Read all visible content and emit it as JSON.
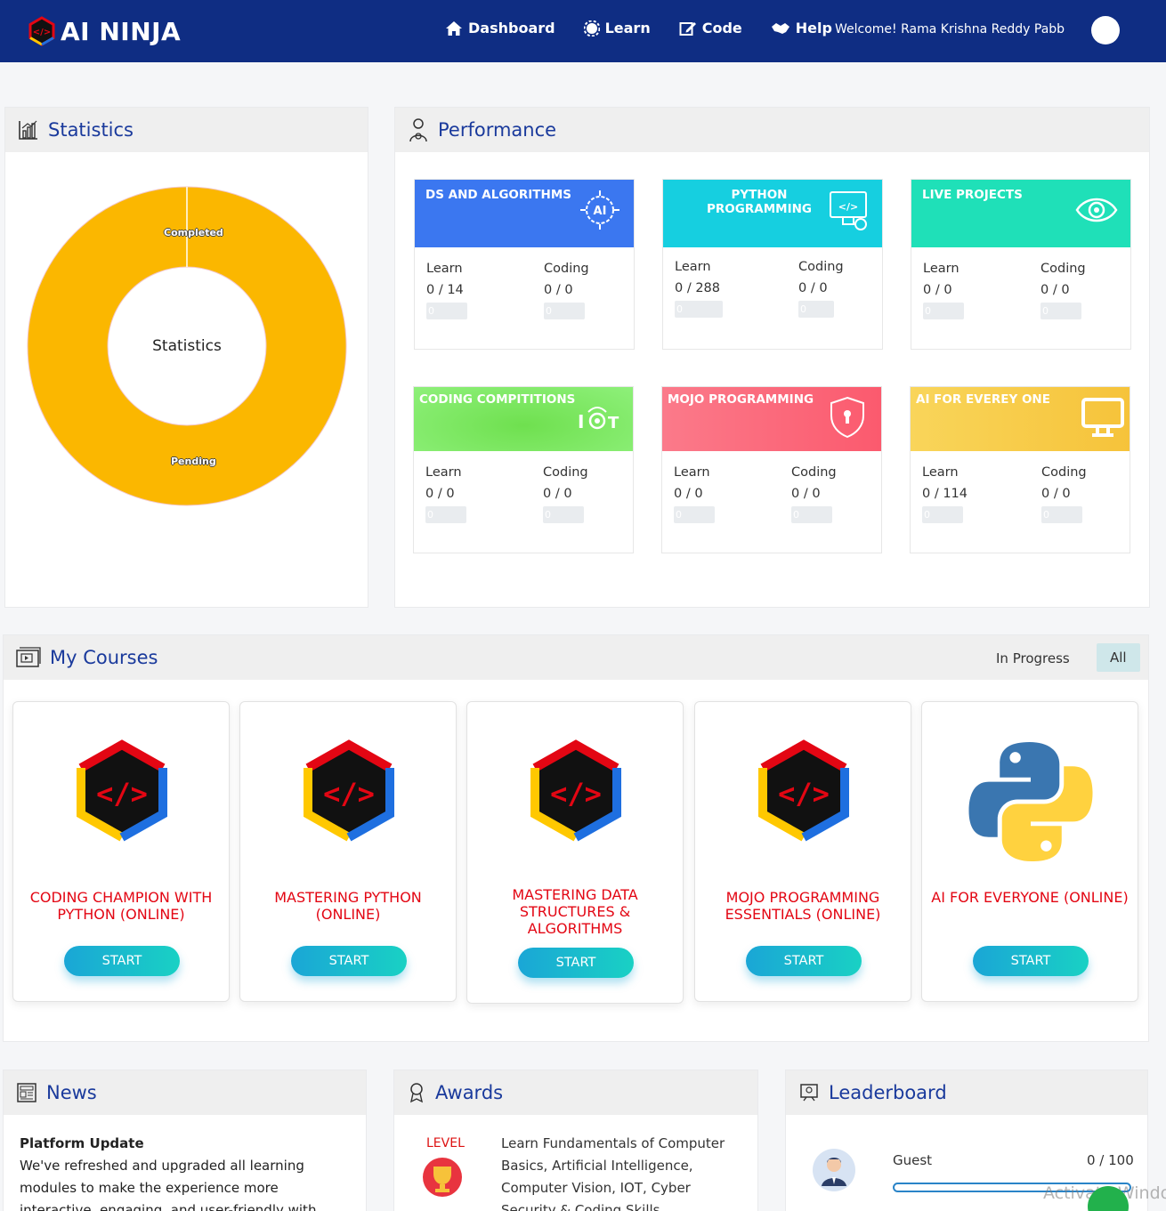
{
  "header": {
    "logo_text": "AI NINJA",
    "nav": [
      {
        "label": "Dashboard",
        "icon": "home-icon"
      },
      {
        "label": "Learn",
        "icon": "gear-icon"
      },
      {
        "label": "Code",
        "icon": "edit-icon"
      },
      {
        "label": "Help",
        "icon": "handshake-icon"
      }
    ],
    "welcome": "Welcome! Rama Krishna Reddy Pabb"
  },
  "statistics": {
    "title": "Statistics",
    "center_label": "Statistics",
    "slices": [
      {
        "label": "Completed",
        "value": 0,
        "color": "#fbb700"
      },
      {
        "label": "Pending",
        "value": 100,
        "color": "#fbb700"
      }
    ]
  },
  "performance": {
    "title": "Performance",
    "cards": [
      {
        "title": "DS AND ALGORITHMS",
        "color": "#3b77f0",
        "icon": "ai-brain-icon",
        "learn_label": "Learn",
        "learn": "0 / 14",
        "learn_bar": "0",
        "coding_label": "Coding",
        "coding": "0 / 0",
        "coding_bar": "0"
      },
      {
        "title": "PYTHON PROGRAMMING",
        "color": "#16cfe0",
        "icon": "code-monitor-icon",
        "learn_label": "Learn",
        "learn": "0 / 288",
        "learn_bar": "0",
        "coding_label": "Coding",
        "coding": "0 / 0",
        "coding_bar": "0"
      },
      {
        "title": "LIVE PROJECTS",
        "color": "#1fe0b8",
        "icon": "eye-icon",
        "learn_label": "Learn",
        "learn": "0 / 0",
        "learn_bar": "0",
        "coding_label": "Coding",
        "coding": "0 / 0",
        "coding_bar": "0"
      },
      {
        "title": "CODING COMPITITIONS",
        "color": "#7ee86a",
        "icon": "iot-icon",
        "learn_label": "Learn",
        "learn": "0 / 0",
        "learn_bar": "0",
        "coding_label": "Coding",
        "coding": "0 / 0",
        "coding_bar": "0"
      },
      {
        "title": "MOJO PROGRAMMING",
        "color": "#fb6f80",
        "icon": "shield-icon",
        "learn_label": "Learn",
        "learn": "0 / 0",
        "learn_bar": "0",
        "coding_label": "Coding",
        "coding": "0 / 0",
        "coding_bar": "0"
      },
      {
        "title": "AI FOR EVEREY ONE",
        "color": "#f9c83c",
        "icon": "monitor-icon",
        "learn_label": "Learn",
        "learn": "0 / 114",
        "learn_bar": "0",
        "coding_label": "Coding",
        "coding": "0 / 0",
        "coding_bar": "0"
      }
    ]
  },
  "courses": {
    "title": "My Courses",
    "tabs": [
      {
        "label": "In Progress",
        "active": false
      },
      {
        "label": "All",
        "active": true
      }
    ],
    "items": [
      {
        "title": "CODING CHAMPION WITH PYTHON (ONLINE)",
        "button": "START",
        "logo": "code-hex-logo-icon"
      },
      {
        "title": "MASTERING PYTHON (ONLINE)",
        "button": "START",
        "logo": "code-hex-logo-icon"
      },
      {
        "title": "MASTERING DATA STRUCTURES & ALGORITHMS",
        "button": "START",
        "logo": "code-hex-logo-icon"
      },
      {
        "title": "MOJO PROGRAMMING ESSENTIALS (ONLINE)",
        "button": "START",
        "logo": "code-hex-logo-icon"
      },
      {
        "title": "AI FOR EVERYONE (ONLINE)",
        "button": "START",
        "logo": "python-logo-icon"
      }
    ]
  },
  "news": {
    "title": "News",
    "heading": "Platform Update",
    "body": "We've refreshed and upgraded all learning modules to make the experience more interactive, engaging, and user-friendly with"
  },
  "awards": {
    "title": "Awards",
    "level_label": "LEVEL",
    "text": "Learn Fundamentals of Computer Basics, Artificial Intelligence, Computer Vision, IOT, Cyber Security & Coding Skills"
  },
  "leaderboard": {
    "title": "Leaderboard",
    "name": "Guest",
    "score": "0 / 100",
    "progress": 0
  },
  "watermark": "Activate Windo"
}
